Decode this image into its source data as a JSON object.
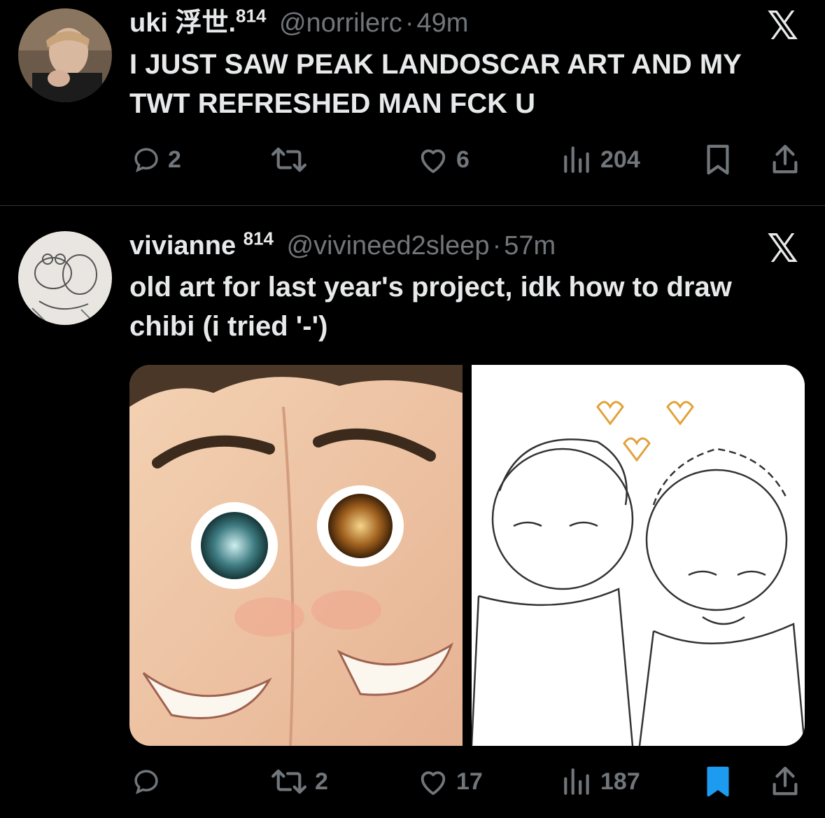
{
  "tweets": [
    {
      "display_name": "uki 浮世.",
      "badge": "814",
      "handle": "@norrilerc",
      "sep": "·",
      "time": "49m",
      "text": "I JUST SAW PEAK LANDOSCAR ART AND MY TWT REFRESHED MAN FCK U",
      "reply_count": "2",
      "retweet_count": "",
      "like_count": "6",
      "view_count": "204",
      "bookmarked": false
    },
    {
      "display_name": "vivianne",
      "badge": "814",
      "handle": "@vivineed2sleep",
      "sep": "·",
      "time": "57m",
      "text": "old art for last year's project, idk how to draw chibi (i tried '-')",
      "reply_count": "",
      "retweet_count": "2",
      "like_count": "17",
      "view_count": "187",
      "bookmarked": true
    }
  ],
  "x_logo": "𝕏",
  "colors": {
    "background": "#000000",
    "text": "#e7e9ea",
    "muted": "#71767b",
    "bookmark_active": "#1d9bf0",
    "divider": "#2f3336"
  },
  "icons": [
    "reply-icon",
    "retweet-icon",
    "like-icon",
    "views-icon",
    "bookmark-icon",
    "share-icon",
    "x-logo-icon"
  ]
}
